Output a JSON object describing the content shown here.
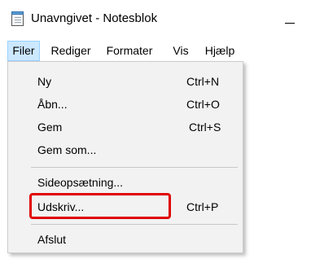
{
  "window": {
    "title": "Unavngivet - Notesblok",
    "icon": "notepad-icon",
    "minimize_icon": "minimize-icon"
  },
  "menubar": {
    "items": [
      {
        "label": "Filer",
        "active": true
      },
      {
        "label": "Rediger",
        "active": false
      },
      {
        "label": "Formater",
        "active": false
      },
      {
        "label": "Vis",
        "active": false
      },
      {
        "label": "Hjælp",
        "active": false
      }
    ]
  },
  "file_menu": {
    "items": [
      {
        "label": "Ny",
        "shortcut": "Ctrl+N"
      },
      {
        "label": "Åbn...",
        "shortcut": "Ctrl+O"
      },
      {
        "label": "Gem",
        "shortcut": "Ctrl+S"
      },
      {
        "label": "Gem som...",
        "shortcut": ""
      },
      {
        "label": "Sideopsætning...",
        "shortcut": ""
      },
      {
        "label": "Udskriv...",
        "shortcut": "Ctrl+P",
        "highlighted": true
      },
      {
        "label": "Afslut",
        "shortcut": ""
      }
    ]
  },
  "colors": {
    "menu_active_bg": "#cce8ff",
    "menu_active_border": "#99d1ff",
    "dropdown_bg": "#f2f2f2",
    "highlight_border": "#e00000"
  }
}
